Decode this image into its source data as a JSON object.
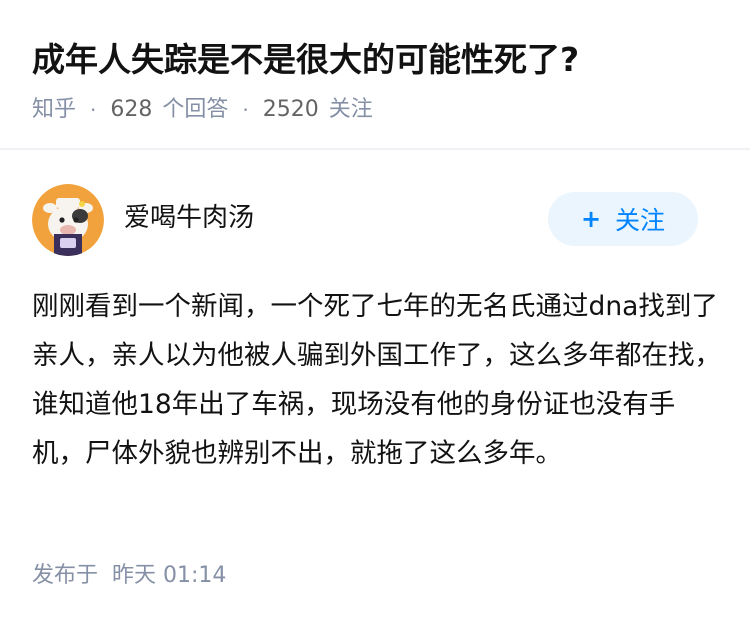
{
  "question": {
    "title": "成年人失踪是不是很大的可能性死了?",
    "source": "知乎",
    "answer_count": "628",
    "answer_label": "个回答",
    "follower_count": "2520",
    "follower_label": "关注",
    "separator": "·"
  },
  "author": {
    "name": "爱喝牛肉汤",
    "avatar_icon": "avatar-cartoon-cow",
    "follow_label": "关注",
    "follow_icon": "plus-icon"
  },
  "answer": {
    "text": "刚刚看到一个新闻，一个死了七年的无名氏通过dna找到了亲人，亲人以为他被人骗到外国工作了，这么多年都在找，谁知道他18年出了车祸，现场没有他的身份证也没有手机，尸体外貌也辨别不出，就拖了这么多年。"
  },
  "publish": {
    "label": "发布于",
    "time": "昨天 01:14"
  },
  "colors": {
    "accent": "#0084ff",
    "follow_bg": "#ebf5fd",
    "meta_text": "#8590a6",
    "divider": "#f0f2f5"
  }
}
